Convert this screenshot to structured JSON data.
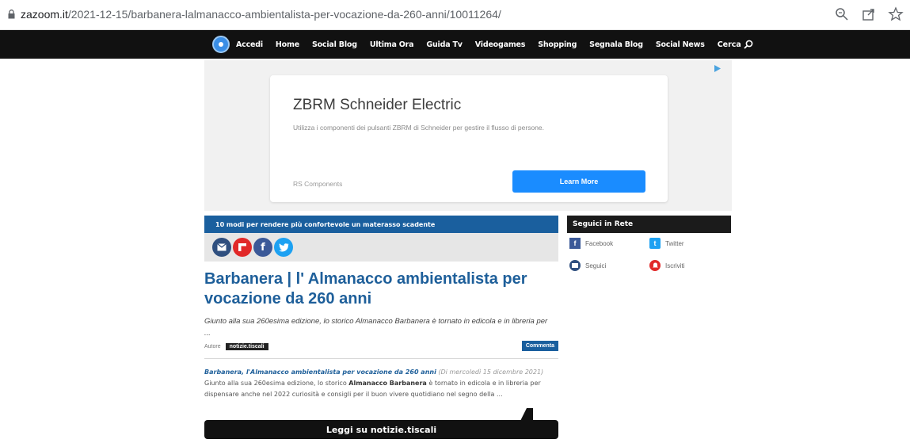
{
  "browser": {
    "url_host": "zazoom.it",
    "url_path": "/2021-12-15/barbanera-lalmanacco-ambientalista-per-vocazione-da-260-anni/10011264/"
  },
  "nav": {
    "items": [
      "Accedi",
      "Home",
      "Social Blog",
      "Ultima Ora",
      "Guida Tv",
      "Videogames",
      "Shopping",
      "Segnala Blog",
      "Social News"
    ],
    "search_label": "Cerca"
  },
  "ad": {
    "title": "ZBRM Schneider Electric",
    "description": "Utilizza i componenti dei pulsanti ZBRM di Schneider per gestire il flusso di persone.",
    "source": "RS Components",
    "button": "Learn More"
  },
  "article": {
    "promo": "10 modi per rendere più confortevole un materasso scadente",
    "title": "Barbanera | l' Almanacco ambientalista per vocazione da 260 anni",
    "summary": "Giunto alla sua 260esima edizione, lo storico Almanacco Barbanera è tornato in edicola e in libreria per ...",
    "author_label": "Autore",
    "author": "notizie.tiscali",
    "comment_button": "Commenta",
    "body_lead": "Barbanera, l'Almanacco ambientalista per vocazione da 260 anni",
    "body_meta": "(Di mercoledì 15 dicembre 2021)",
    "body_part1": "Giunto alla sua 260esima edizione, lo storico",
    "body_bold": "Almanacco Barbanera",
    "body_part2": "è tornato in edicola e in libreria per dispensare anche nel 2022 curiosità e consigli per il buon vivere quotidiano nel segno della ...",
    "read_button": "Leggi su notizie.tiscali"
  },
  "sidebar": {
    "heading": "Seguici in Rete",
    "items": [
      {
        "label": "Facebook",
        "icon": "facebook-icon"
      },
      {
        "label": "Twitter",
        "icon": "twitter-icon"
      },
      {
        "label": "Seguici",
        "icon": "follow-icon"
      },
      {
        "label": "Iscriviti",
        "icon": "subscribe-icon"
      }
    ]
  },
  "colors": {
    "accent_blue": "#1e5f9a",
    "nav_black": "#111111",
    "ad_button": "#1a8cff"
  }
}
